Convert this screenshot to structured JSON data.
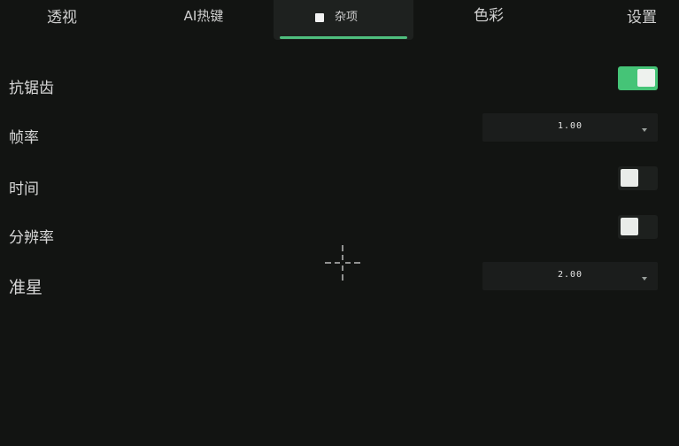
{
  "tabs": [
    {
      "label": "透视",
      "active": false
    },
    {
      "label": "AI热键",
      "active": false
    },
    {
      "label": "杂项",
      "active": true
    },
    {
      "label": "色彩",
      "active": false
    },
    {
      "label": "设置",
      "active": false
    }
  ],
  "settings": {
    "antialias": {
      "label": "抗锯齿",
      "type": "toggle",
      "on": true
    },
    "framerate": {
      "label": "帧率",
      "type": "dropdown",
      "value": "1.00"
    },
    "time": {
      "label": "时间",
      "type": "toggle",
      "on": false
    },
    "resolution": {
      "label": "分辨率",
      "type": "toggle",
      "on": false
    },
    "crosshair": {
      "label": "准星",
      "type": "dropdown",
      "value": "2.00"
    }
  },
  "colors": {
    "background": "#121412",
    "accent": "#45c477",
    "underline": "#4fbf7e"
  },
  "icons": {
    "tab_check": "checkbox-icon",
    "dropdown_arrow": "chevron-down-icon",
    "crosshair": "crosshair-icon"
  }
}
